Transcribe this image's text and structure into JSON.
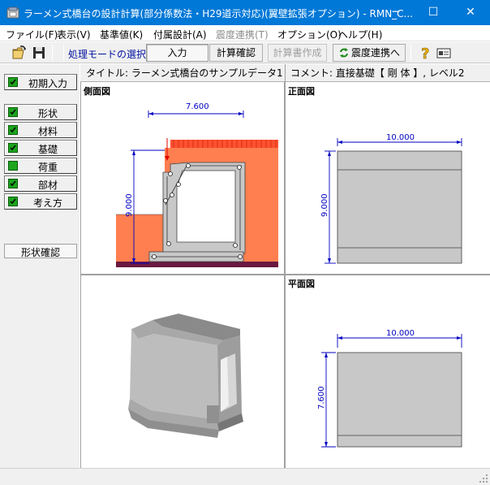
{
  "window": {
    "title": "ラーメン式橋台の設計計算(部分係数法・H29道示対応)(翼壁拡張オプション) - RMN_C...",
    "minimize": "─",
    "maximize": "☐",
    "close": "✕"
  },
  "menu": [
    {
      "label": "ファイル(F)",
      "disabled": false
    },
    {
      "label": "表示(V)",
      "disabled": false
    },
    {
      "label": "基準値(K)",
      "disabled": false
    },
    {
      "label": "付属設計(A)",
      "disabled": false
    },
    {
      "label": "震度連携(T)",
      "disabled": true
    },
    {
      "label": "オプション(O)",
      "disabled": false
    },
    {
      "label": "ヘルプ(H)",
      "disabled": false
    }
  ],
  "toolbar": {
    "mode_label": "処理モードの選択",
    "input": "入力",
    "calc_check": "計算確認",
    "report": "計算書作成",
    "seismic_link": "震度連携へ"
  },
  "sidebar": {
    "initial_input": "初期入力",
    "items": [
      "形状",
      "材料",
      "基礎",
      "荷重",
      "部材",
      "考え方"
    ],
    "shape_check": "形状確認"
  },
  "info": {
    "title": "タイトル: ラーメン式橋台のサンプルデータ1",
    "comment": "コメント: 直接基礎【 剛  体 】, レベル2"
  },
  "views": {
    "side": {
      "label": "側面図",
      "width_dim": "7.600",
      "height_dim": "9.000"
    },
    "front": {
      "label": "正面図",
      "width_dim": "10.000",
      "height_dim": "9.000"
    },
    "plan": {
      "label": "平面図",
      "width_dim": "10.000",
      "height_dim": "7.600"
    }
  },
  "colors": {
    "titlebar": "#0078d7",
    "soil": "#ff7f50",
    "concrete": "#c8c8c8",
    "dimension": "#0000c0",
    "check_green": "#1ea51e"
  }
}
